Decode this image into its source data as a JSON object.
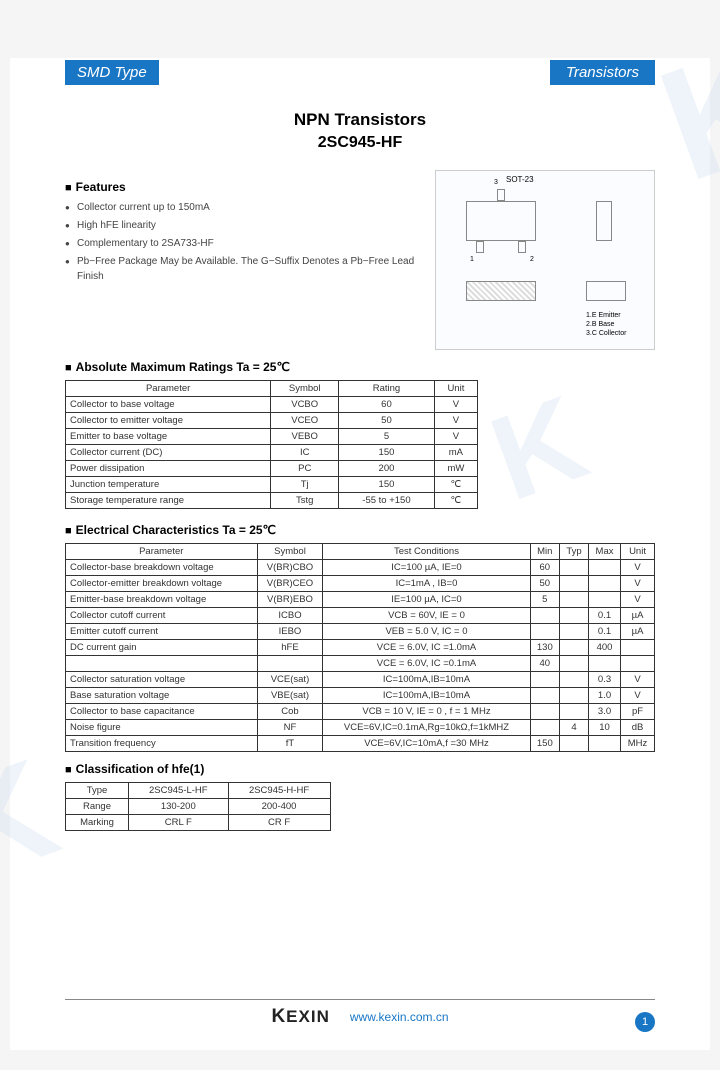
{
  "banner": {
    "left": "SMD Type",
    "right": "Transistors"
  },
  "titles": {
    "line1": "NPN  Transistors",
    "line2": "2SC945-HF"
  },
  "sections": {
    "features": "Features",
    "abs_max": "Absolute Maximum Ratings Ta = 25℃",
    "elec": "Electrical Characteristics Ta = 25℃",
    "classif": "Classification of hfe(1)"
  },
  "features": [
    "Collector current up to 150mA",
    "High hFE linearity",
    "Complementary to 2SA733-HF",
    "Pb−Free Package May be Available. The G−Suffix Denotes a Pb−Free Lead Finish"
  ],
  "abs_max": {
    "headers": [
      "Parameter",
      "Symbol",
      "Rating",
      "Unit"
    ],
    "rows": [
      [
        "Collector to base voltage",
        "VCBO",
        "60",
        "V"
      ],
      [
        "Collector to emitter voltage",
        "VCEO",
        "50",
        "V"
      ],
      [
        "Emitter to base voltage",
        "VEBO",
        "5",
        "V"
      ],
      [
        "Collector current (DC)",
        "IC",
        "150",
        "mA"
      ],
      [
        "Power dissipation",
        "PC",
        "200",
        "mW"
      ],
      [
        "Junction temperature",
        "Tj",
        "150",
        "℃"
      ],
      [
        "Storage temperature range",
        "Tstg",
        "-55 to +150",
        "℃"
      ]
    ]
  },
  "elec": {
    "headers": [
      "Parameter",
      "Symbol",
      "Test Conditions",
      "Min",
      "Typ",
      "Max",
      "Unit"
    ],
    "rows": [
      [
        "Collector-base breakdown voltage",
        "V(BR)CBO",
        "IC=100 µA, IE=0",
        "60",
        "",
        "",
        "V"
      ],
      [
        "Collector-emitter breakdown voltage",
        "V(BR)CEO",
        "IC=1mA , IB=0",
        "50",
        "",
        "",
        "V"
      ],
      [
        "Emitter-base breakdown voltage",
        "V(BR)EBO",
        "IE=100 µA, IC=0",
        "5",
        "",
        "",
        "V"
      ],
      [
        "Collector cutoff current",
        "ICBO",
        "VCB = 60V, IE = 0",
        "",
        "",
        "0.1",
        "µA"
      ],
      [
        "Emitter cutoff current",
        "IEBO",
        "VEB = 5.0 V, IC = 0",
        "",
        "",
        "0.1",
        "µA"
      ],
      [
        "DC current gain",
        "hFE",
        "VCE = 6.0V, IC =1.0mA",
        "130",
        "",
        "400",
        ""
      ],
      [
        "",
        "",
        "VCE = 6.0V, IC =0.1mA",
        "40",
        "",
        "",
        ""
      ],
      [
        "Collector saturation voltage",
        "VCE(sat)",
        "IC=100mA,IB=10mA",
        "",
        "",
        "0.3",
        "V"
      ],
      [
        "Base saturation voltage",
        "VBE(sat)",
        "IC=100mA,IB=10mA",
        "",
        "",
        "1.0",
        "V"
      ],
      [
        "Collector to base capacitance",
        "Cob",
        "VCB = 10 V, IE = 0 , f = 1 MHz",
        "",
        "",
        "3.0",
        "pF"
      ],
      [
        "Noise figure",
        "NF",
        "VCE=6V,IC=0.1mA,Rg=10kΩ,f=1kMHZ",
        "",
        "4",
        "10",
        "dB"
      ],
      [
        "Transition frequency",
        "fT",
        "VCE=6V,IC=10mA,f =30 MHz",
        "150",
        "",
        "",
        "MHz"
      ]
    ]
  },
  "classif": {
    "headers": [
      "Type",
      "2SC945-L-HF",
      "2SC945-H-HF"
    ],
    "rows": [
      [
        "Range",
        "130-200",
        "200-400"
      ],
      [
        "Marking",
        "CRL F",
        "CR F"
      ]
    ]
  },
  "footer": {
    "brand": "KEXIN",
    "url": "www.kexin.com.cn",
    "page": "1"
  },
  "diagram_label": "SOT-23"
}
